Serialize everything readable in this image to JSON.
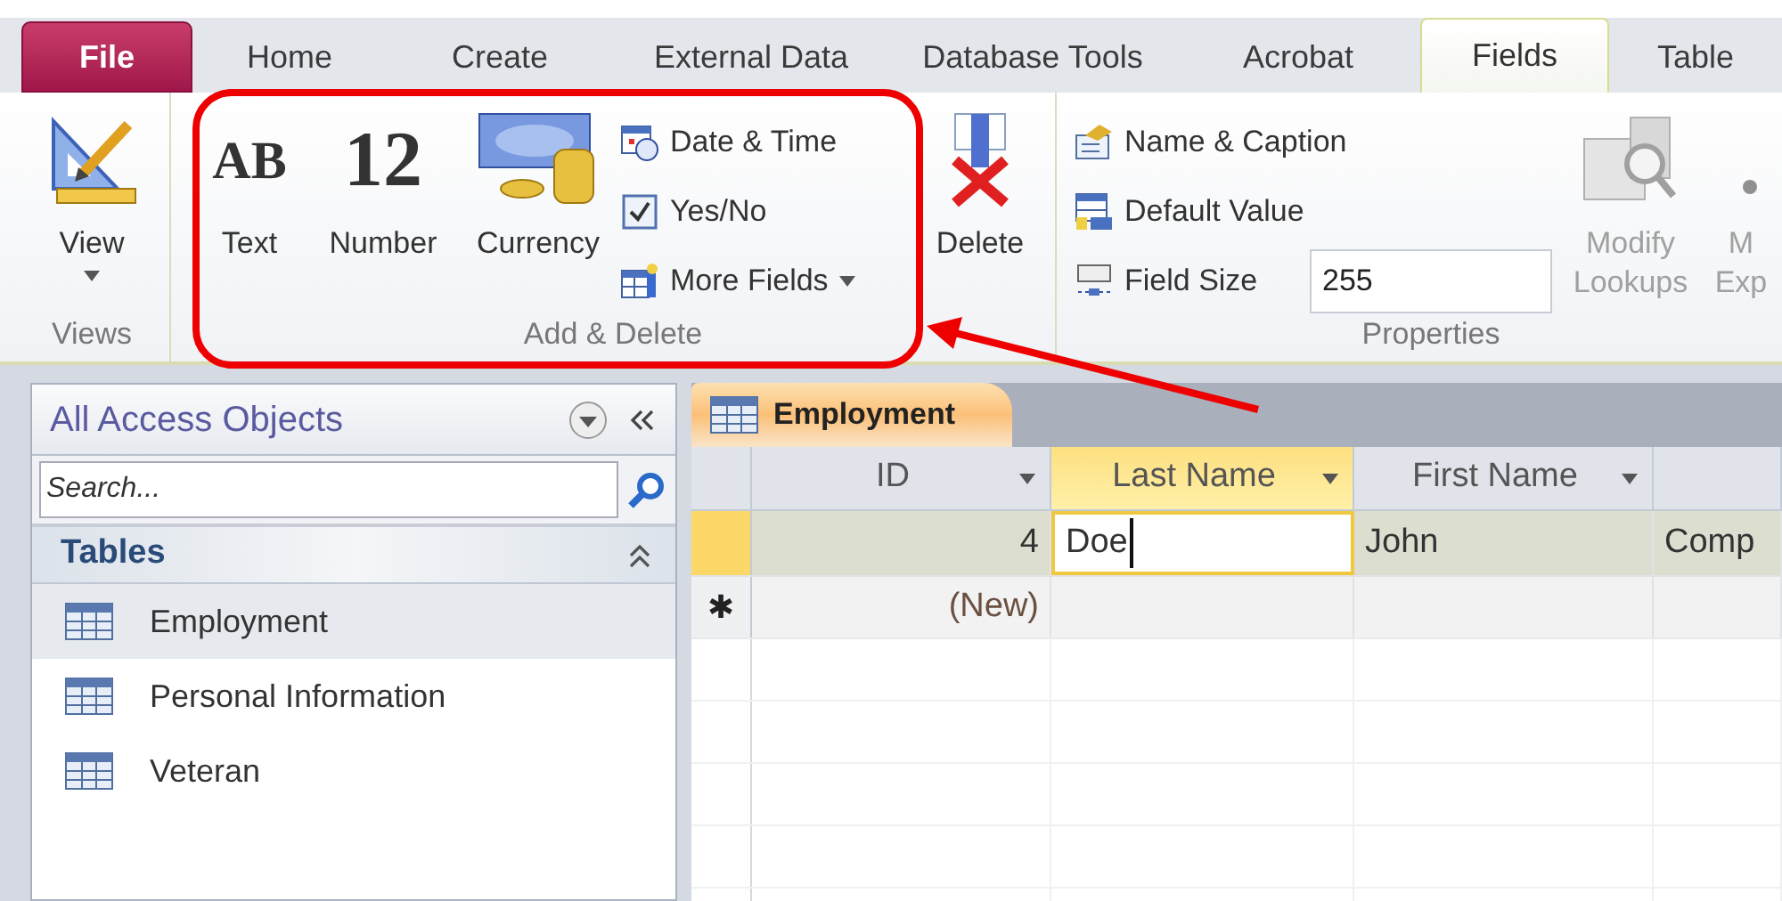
{
  "ribbon_tabs": [
    {
      "label": "File",
      "kind": "file",
      "selected": false
    },
    {
      "label": "Home",
      "kind": "tab",
      "selected": false
    },
    {
      "label": "Create",
      "kind": "tab",
      "selected": false
    },
    {
      "label": "External Data",
      "kind": "tab",
      "selected": false
    },
    {
      "label": "Database Tools",
      "kind": "tab",
      "selected": false
    },
    {
      "label": "Acrobat",
      "kind": "tab",
      "selected": false
    },
    {
      "label": "Fields",
      "kind": "tab",
      "selected": true
    },
    {
      "label": "Table",
      "kind": "tab",
      "selected": false
    }
  ],
  "ribbon_groups": [
    {
      "label": "Views",
      "items": [
        {
          "kind": "large",
          "lines": [
            "View"
          ],
          "dropdown": true,
          "disabled": false
        }
      ]
    },
    {
      "label": "Add & Delete",
      "items": [
        {
          "kind": "large",
          "icon_text": "AB",
          "lines": [
            "Text"
          ],
          "dropdown": false,
          "disabled": false
        },
        {
          "kind": "large",
          "icon_text": "12",
          "lines": [
            "Number"
          ],
          "dropdown": false,
          "disabled": false
        },
        {
          "kind": "large",
          "lines": [
            "Currency"
          ],
          "dropdown": false,
          "disabled": false
        },
        {
          "kind": "stack",
          "rows": [
            {
              "label": "Date & Time",
              "dropdown": false
            },
            {
              "label": "Yes/No",
              "dropdown": false
            },
            {
              "label": "More Fields",
              "dropdown": true
            }
          ]
        },
        {
          "kind": "large",
          "lines": [
            "Delete"
          ],
          "dropdown": false,
          "disabled": false
        }
      ]
    },
    {
      "label": "Properties",
      "items": [
        {
          "kind": "stack",
          "rows": [
            {
              "label": "Name & Caption",
              "dropdown": false
            },
            {
              "label": "Default Value",
              "dropdown": false
            },
            {
              "label": "Field Size",
              "dropdown": false,
              "value": "255"
            }
          ]
        },
        {
          "kind": "large",
          "lines": [
            "Modify",
            "Lookups"
          ],
          "dropdown": false,
          "disabled": true
        },
        {
          "kind": "large",
          "lines": [
            "M",
            "Exp"
          ],
          "dropdown": false,
          "disabled": true
        }
      ]
    }
  ],
  "nav_pane": {
    "title": "All Access Objects",
    "search": {
      "placeholder": "Search..."
    },
    "sections": [
      {
        "label": "Tables",
        "expanded": true,
        "items": [
          {
            "label": "Employment",
            "selected": true
          },
          {
            "label": "Personal Information",
            "selected": false
          },
          {
            "label": "Veteran",
            "selected": false
          }
        ]
      }
    ]
  },
  "datasheet": {
    "tab": "Employment",
    "columns": [
      {
        "label": "ID",
        "selected": false
      },
      {
        "label": "Last Name",
        "selected": true
      },
      {
        "label": "First Name",
        "selected": false
      }
    ],
    "rows": [
      {
        "selected": true,
        "cells": [
          {
            "text": "4",
            "editing": false
          },
          {
            "text": "Doe",
            "editing": true
          },
          {
            "text": "John",
            "editing": false
          },
          {
            "text": "Comp",
            "editing": false
          }
        ]
      }
    ],
    "new_row": {
      "marker": "✱",
      "id": "(New)"
    }
  }
}
